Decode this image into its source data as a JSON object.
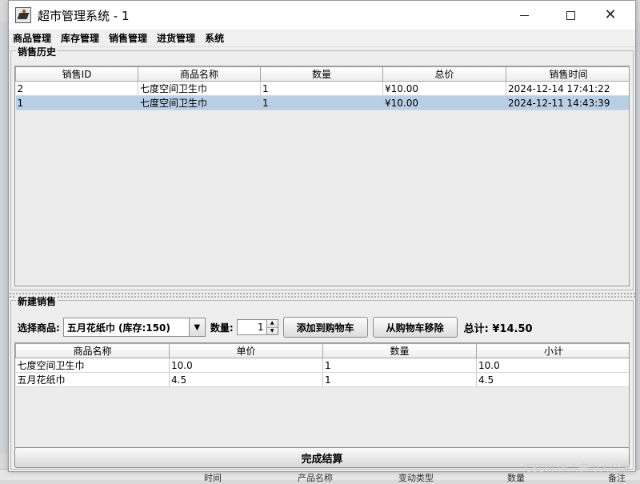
{
  "window": {
    "title": "超市管理系统 - 1"
  },
  "menu": [
    "商品管理",
    "库存管理",
    "销售管理",
    "进货管理",
    "系统"
  ],
  "history": {
    "title": "销售历史",
    "columns": [
      "销售ID",
      "商品名称",
      "数量",
      "总价",
      "销售时间"
    ],
    "rows": [
      {
        "id": "2",
        "name": "七度空间卫生巾",
        "qty": "1",
        "total": "¥10.00",
        "time": "2024-12-14 17:41:22"
      },
      {
        "id": "1",
        "name": "七度空间卫生巾",
        "qty": "1",
        "total": "¥10.00",
        "time": "2024-12-11 14:43:39",
        "selected": true
      }
    ]
  },
  "new_sale": {
    "title": "新建销售",
    "select_label": "选择商品:",
    "selected_product": "五月花纸巾 (库存:150)",
    "qty_label": "数量:",
    "qty_value": "1",
    "add_button": "添加到购物车",
    "remove_button": "从购物车移除",
    "total_text": "总计: ¥14.50",
    "cart_columns": [
      "商品名称",
      "单价",
      "数量",
      "小计"
    ],
    "cart_rows": [
      {
        "name": "七度空间卫生巾",
        "price": "10.0",
        "qty": "1",
        "subtotal": "10.0"
      },
      {
        "name": "五月花纸巾",
        "price": "4.5",
        "qty": "1",
        "subtotal": "4.5"
      }
    ],
    "checkout_button": "完成结算"
  },
  "background": {
    "bottom_columns": [
      "时间",
      "产品名称",
      "变动类型",
      "数量",
      "备注"
    ]
  },
  "watermark": "CSDN @六奇の大公猴"
}
